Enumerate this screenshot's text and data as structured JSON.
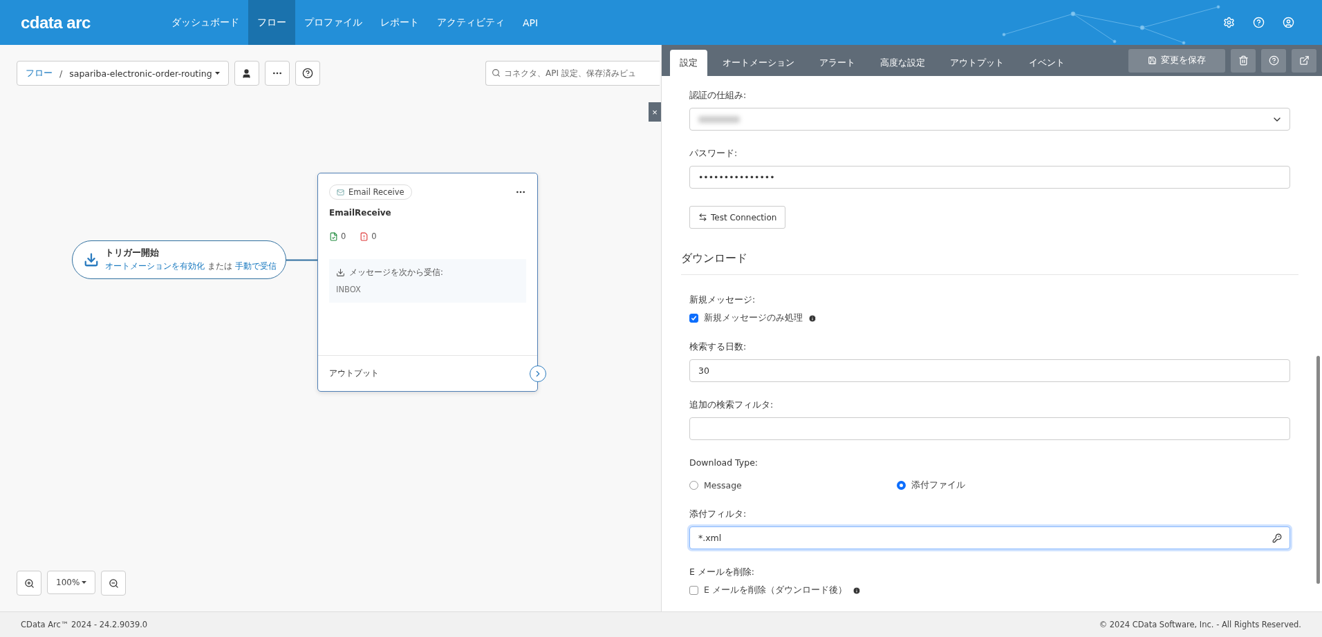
{
  "header": {
    "logo": "cdata arc",
    "nav": [
      {
        "label": "ダッシュボード",
        "selected": false
      },
      {
        "label": "フロー",
        "selected": true
      },
      {
        "label": "プロファイル",
        "selected": false
      },
      {
        "label": "レポート",
        "selected": false
      },
      {
        "label": "アクティビティ",
        "selected": false
      },
      {
        "label": "API",
        "selected": false
      }
    ]
  },
  "canvas": {
    "breadcrumb": {
      "root": "フロー",
      "separator": "/",
      "flow": "sapariba-electronic-order-routing"
    },
    "search": {
      "placeholder": "コネクタ、API 設定、保存済みビュ"
    },
    "close": "×",
    "trigger": {
      "title": "トリガー開始",
      "link_1": "オートメーションを有効化",
      "joiner": "または",
      "link_2": "手動で受信"
    },
    "node": {
      "badge": "Email Receive",
      "name": "EmailReceive",
      "success_count": "0",
      "error_count": "0",
      "source_label": "メッセージを次から受信:",
      "source": "INBOX",
      "output": "アウトプット"
    },
    "zoom": "100%"
  },
  "panel": {
    "tabs": [
      {
        "label": "設定",
        "selected": true
      },
      {
        "label": "オートメーション",
        "selected": false
      },
      {
        "label": "アラート",
        "selected": false
      },
      {
        "label": "高度な設定",
        "selected": false
      },
      {
        "label": "アウトプット",
        "selected": false
      },
      {
        "label": "イベント",
        "selected": false
      }
    ],
    "save": "変更を保存",
    "fields": [
      {
        "kind": "select",
        "label": "認証の仕組み:"
      },
      {
        "kind": "input",
        "label": "パスワード:",
        "value": "•••••••••••••••",
        "focused": false
      },
      {
        "kind": "button",
        "label": "Test Connection"
      },
      {
        "kind": "heading",
        "label": "ダウンロード"
      },
      {
        "kind": "checkbox",
        "label": "新規メッセージ:",
        "option": "新規メッセージのみ処理",
        "checked": true
      },
      {
        "kind": "input",
        "label": "検索する日数:",
        "value": "30",
        "focused": false
      },
      {
        "kind": "input",
        "label": "追加の検索フィルタ:",
        "focused": false
      },
      {
        "kind": "radio",
        "label": "Download Type:",
        "options": [
          {
            "label": "Message",
            "selected": false
          },
          {
            "label": "添付ファイル",
            "selected": true
          }
        ]
      },
      {
        "kind": "input",
        "label": "添付フィルタ:",
        "value": "*.xml",
        "focused": true
      },
      {
        "kind": "checkbox",
        "label": "E メールを削除:",
        "option": "E メールを削除（ダウンロード後）",
        "checked": false
      }
    ]
  },
  "footer": {
    "version": "CData Arc™ 2024 - 24.2.9039.0",
    "copyright": "© 2024 CData Software, Inc. - All Rights Reserved."
  }
}
